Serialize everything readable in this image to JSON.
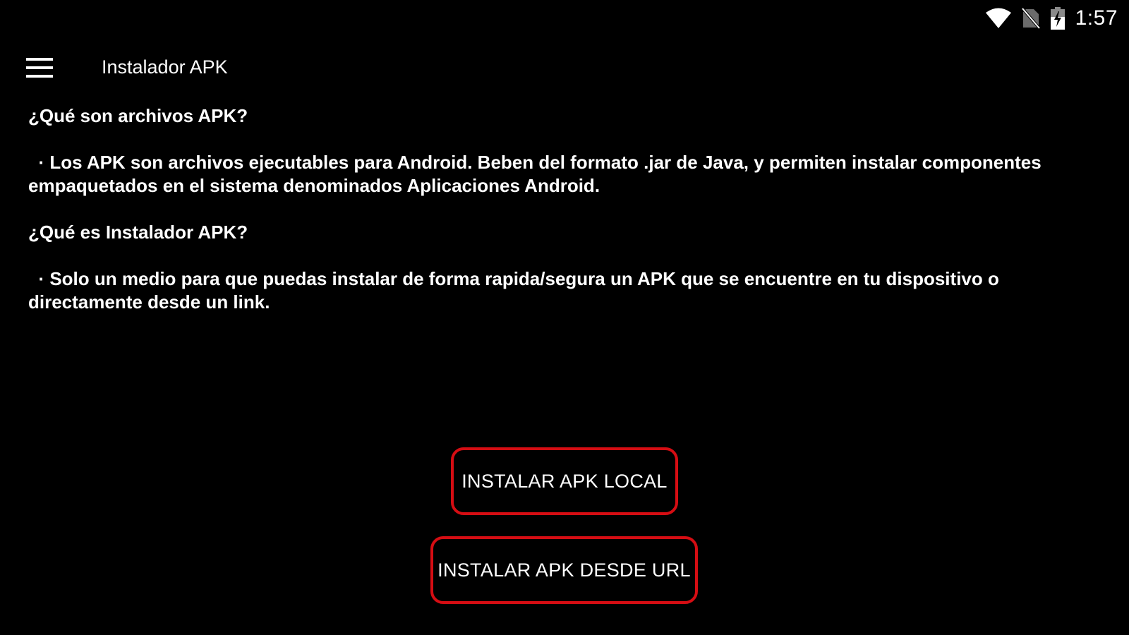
{
  "status_bar": {
    "icons": [
      "wifi-icon",
      "no-sim-icon",
      "battery-charging-icon"
    ],
    "time": "1:57"
  },
  "toolbar": {
    "menu_icon": "hamburger-menu-icon",
    "title": "Instalador APK"
  },
  "content": {
    "q1_heading": "¿Qué son archivos APK?",
    "q1_answer": "  · Los APK son archivos ejecutables para Android. Beben del formato .jar de Java, y permiten instalar componentes empaquetados en el sistema denominados Aplicaciones Android.",
    "q2_heading": "¿Qué es Instalador APK?",
    "q2_answer": "  · Solo un medio para que puedas instalar de forma rapida/segura un APK que se encuentre en tu dispositivo o directamente desde un link."
  },
  "buttons": {
    "local_label": "INSTALAR APK LOCAL",
    "url_label": "INSTALAR APK DESDE URL"
  },
  "colors": {
    "background": "#000000",
    "text": "#ffffff",
    "button_border": "#d50d13"
  }
}
